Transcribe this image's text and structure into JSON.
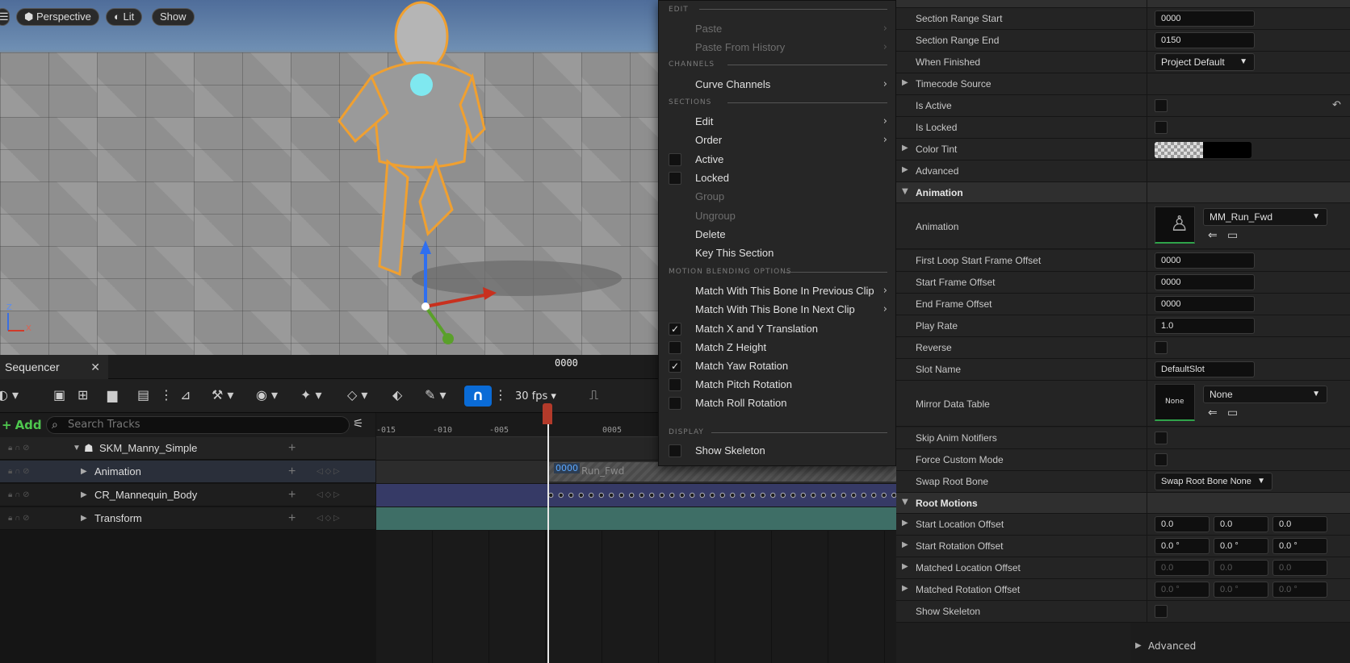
{
  "viewport": {
    "perspective_label": "Perspective",
    "lit_label": "Lit",
    "show_label": "Show",
    "axis_z": "Z",
    "axis_x": "X"
  },
  "sequencer": {
    "tab_label": "Sequencer",
    "fps_label": "30 fps",
    "add_label": "Add",
    "search_placeholder": "Search Tracks",
    "ruler_ticks": [
      "-015",
      "-010",
      "-005",
      "0005"
    ],
    "current_frame": "0000",
    "section_frame": "0000",
    "section_name": "Run_Fwd",
    "tracks": [
      {
        "label": "SKM_Manny_Simple",
        "level": 0
      },
      {
        "label": "Animation",
        "level": 1
      },
      {
        "label": "CR_Mannequin_Body",
        "level": 1
      },
      {
        "label": "Transform",
        "level": 1
      }
    ]
  },
  "context_menu": {
    "edit_header": "EDIT",
    "paste": "Paste",
    "paste_history": "Paste From History",
    "channels_header": "CHANNELS",
    "curve_channels": "Curve Channels",
    "sections_header": "SECTIONS",
    "edit": "Edit",
    "order": "Order",
    "active": "Active",
    "locked": "Locked",
    "group": "Group",
    "ungroup": "Ungroup",
    "delete": "Delete",
    "key_section": "Key This Section",
    "motion_header": "MOTION BLENDING OPTIONS",
    "match_prev": "Match With This Bone In Previous Clip",
    "match_next": "Match With This Bone In Next Clip",
    "match_xy": "Match X and Y Translation",
    "match_z": "Match Z Height",
    "match_yaw": "Match Yaw Rotation",
    "match_pitch": "Match Pitch Rotation",
    "match_roll": "Match Roll Rotation",
    "display_header": "DISPLAY",
    "show_skeleton": "Show Skeleton",
    "checked": "✓"
  },
  "details": {
    "section_range_start": {
      "label": "Section Range Start",
      "value": "0000"
    },
    "section_range_end": {
      "label": "Section Range End",
      "value": "0150"
    },
    "when_finished": {
      "label": "When Finished",
      "value": "Project Default"
    },
    "timecode_source": "Timecode Source",
    "is_active": "Is Active",
    "is_locked": "Is Locked",
    "color_tint": "Color Tint",
    "advanced": "Advanced",
    "animation_cat": "Animation",
    "animation": {
      "label": "Animation",
      "value": "MM_Run_Fwd"
    },
    "first_loop": {
      "label": "First Loop Start Frame Offset",
      "value": "0000"
    },
    "start_frame": {
      "label": "Start Frame Offset",
      "value": "0000"
    },
    "end_frame": {
      "label": "End Frame Offset",
      "value": "0000"
    },
    "play_rate": {
      "label": "Play Rate",
      "value": "1.0"
    },
    "reverse": "Reverse",
    "slot_name": {
      "label": "Slot Name",
      "value": "DefaultSlot"
    },
    "mirror": {
      "label": "Mirror Data Table",
      "value": "None",
      "thumb": "None"
    },
    "skip_notifiers": "Skip Anim Notifiers",
    "force_custom": "Force Custom Mode",
    "swap_root": {
      "label": "Swap Root Bone",
      "value": "Swap Root Bone None"
    },
    "root_motions_cat": "Root Motions",
    "start_loc": {
      "label": "Start Location Offset",
      "values": [
        "0.0",
        "0.0",
        "0.0"
      ]
    },
    "start_rot": {
      "label": "Start Rotation Offset",
      "values": [
        "0.0 °",
        "0.0 °",
        "0.0 °"
      ]
    },
    "matched_loc": {
      "label": "Matched Location Offset",
      "values": [
        "0.0",
        "0.0",
        "0.0"
      ]
    },
    "matched_rot": {
      "label": "Matched Rotation Offset",
      "values": [
        "0.0 °",
        "0.0 °",
        "0.0 °"
      ]
    },
    "show_skeleton": "Show Skeleton",
    "advanced_bottom": "Advanced"
  },
  "colors": {
    "accent": "#0a6bd6",
    "selection": "#f0a030",
    "transform_lane": "#3e6e66",
    "body_lane": "#3a3f70"
  }
}
